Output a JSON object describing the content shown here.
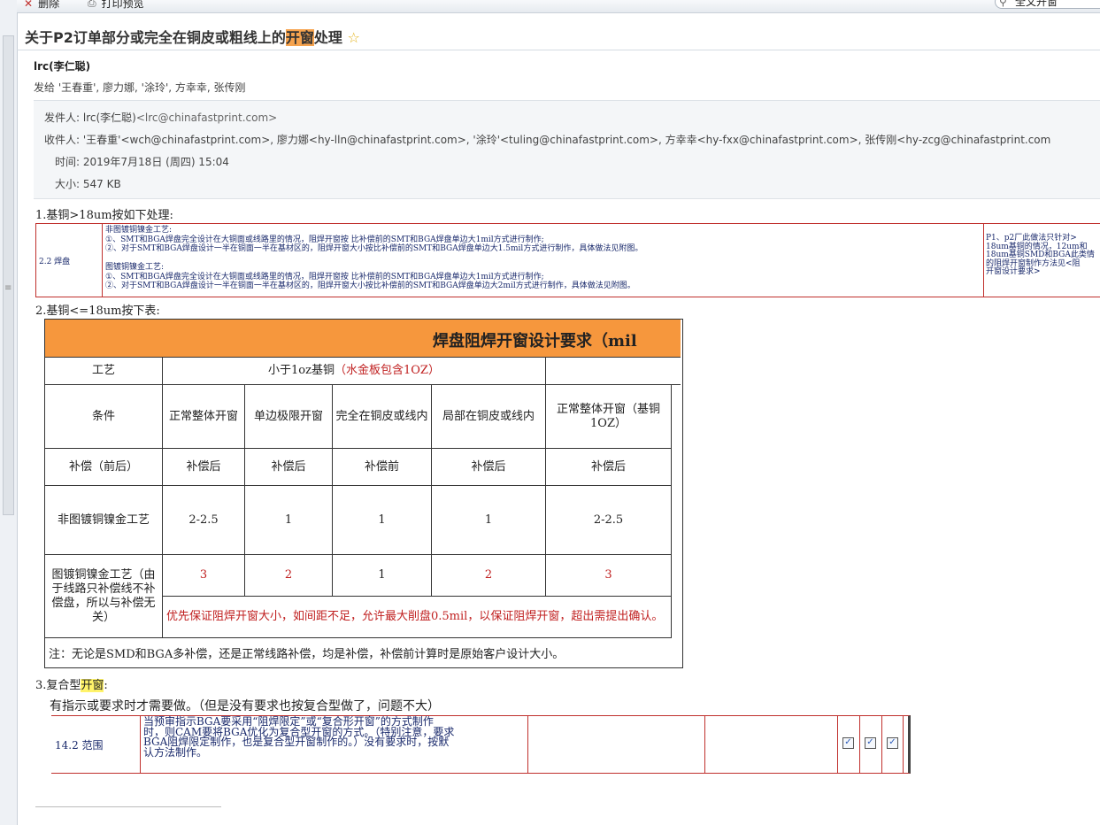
{
  "toolbar": {
    "delete_label": "删除",
    "print_label": "打印预览",
    "search_value": "全文开窗"
  },
  "email": {
    "subject_prefix": "关于P2订单部分或完全在铜皮或粗线上的",
    "subject_highlight": "开窗",
    "subject_suffix": "处理",
    "sender": "lrc(李仁聪)",
    "send_to": "发给 '王春重', 廖力娜, '涂玲', 方幸幸, 张传刚",
    "from_label": "发件人:",
    "from_name": "lrc(李仁聪)",
    "from_addr": "<lrc@chinafastprint.com>",
    "to_label": "收件人:",
    "to_value": "'王春重'<wch@chinafastprint.com>, 廖力娜<hy-lln@chinafastprint.com>, '涂玲'<tuling@chinafastprint.com>, 方幸幸<hy-fxx@chinafastprint.com>, 张传刚<hy-zcg@chinafastprint.com",
    "time_label": "时间:",
    "time_value": "2019年7月18日 (周四) 15:04",
    "size_label": "大小:",
    "size_value": "547 KB"
  },
  "body": {
    "section1": "1.基铜>18um按如下处理:",
    "t1_label": "2.2 焊盘",
    "t1_lines": [
      "非图镀铜镍金工艺:",
      "①、SMT和BGA焊盘完全设计在大铜面或线路里的情况，阻焊开窗按 比补偿前的SMT和BGA焊盘单边大1mil方式进行制作;",
      "②、对于SMT和BGA焊盘设计一半在铜面一半在基材区的，阻焊开窗大小按比补偿前的SMT和BGA焊盘单边大1.5mil方式进行制作，具体做法见附图。",
      "",
      "图镀铜镍金工艺:",
      "①、SMT和BGA焊盘完全设计在大铜面或线路里的情况，阻焊开窗按 比补偿前的SMT和BGA焊盘单边大1mil方式进行制作;",
      "②、对于SMT和BGA焊盘设计一半在铜面一半在基材区的，阻焊开窗大小按比补偿前的SMT和BGA焊盘单边大2mil方式进行制作，具体做法见附图。"
    ],
    "t1_right": [
      "P1、p2厂此做法只针对>",
      "18um基铜的情况，12um和",
      "18um基铜SMD和BGA此类情",
      "的阻焊开窗制作方法见<阻",
      "开窗设计要求>"
    ],
    "section2": "2.基铜<=18um按下表:",
    "table2": {
      "title": "焊盘阻焊开窗设计要求（mil",
      "h_process": "工艺",
      "h_group": "小于1oz基铜",
      "h_group_red": "（水金板包含1OZ）",
      "h_cond": "条件",
      "cond": [
        "正常整体开窗",
        "单边极限开窗",
        "完全在铜皮或线内",
        "局部在铜皮或线内",
        "正常整体开窗（基铜1OZ）"
      ],
      "h_comp": "补偿（前后）",
      "comp": [
        "补偿后",
        "补偿后",
        "补偿前",
        "补偿后",
        "补偿后"
      ],
      "row1_label": "非图镀铜镍金工艺",
      "row1": [
        "2-2.5",
        "1",
        "1",
        "1",
        "2-2.5"
      ],
      "row2_label": "图镀铜镍金工艺（由于线路只补偿线不补偿盘，所以与补偿无关）",
      "row2": [
        "3",
        "2",
        "1",
        "2",
        "3"
      ],
      "row2_note": "优先保证阻焊开窗大小，如间距不足，允许最大削盘0.5mil，以保证阻焊开窗，超出需提出确认。",
      "footnote": "注：无论是SMD和BGA多补偿，还是正常线路补偿，均是补偿，补偿前计算时是原始客户设计大小。"
    },
    "section3_prefix": "3.复合型",
    "section3_highlight": "开窗",
    "section3_suffix": ":",
    "section3_desc": "有指示或要求时才需要做。（但是没有要求也按复合型做了，问题不大）",
    "t3_label": "14.2 范围",
    "t3_text": [
      "当预审指示BGA要采用“阻焊限定”或“复合形开窗”的方式制作",
      "时，则CAM要将BGA优化为复合型开窗的方式。（特别注意，要求",
      "BGA阻焊限定制作，也是复合型开窗制作的。）没有要求时，按默",
      "认方法制作。"
    ],
    "t3_checks": [
      "✓",
      "✓",
      "✓"
    ]
  }
}
